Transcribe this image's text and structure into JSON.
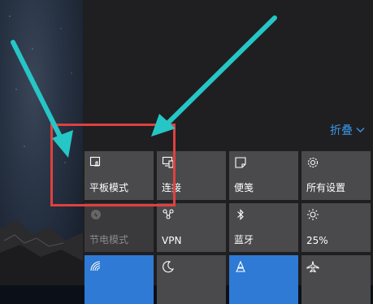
{
  "action_center": {
    "collapse_label": "折叠"
  },
  "tiles": [
    {
      "label": "平板模式",
      "icon": "tablet-mode-icon",
      "state": "active"
    },
    {
      "label": "连接",
      "icon": "connect-icon",
      "state": "normal"
    },
    {
      "label": "便笺",
      "icon": "note-icon",
      "state": "normal"
    },
    {
      "label": "所有设置",
      "icon": "gear-icon",
      "state": "normal"
    },
    {
      "label": "节电模式",
      "icon": "battery-saver-icon",
      "state": "disabled"
    },
    {
      "label": "VPN",
      "icon": "vpn-icon",
      "state": "normal"
    },
    {
      "label": "蓝牙",
      "icon": "bluetooth-icon",
      "state": "normal"
    },
    {
      "label": "25%",
      "icon": "brightness-icon",
      "state": "normal"
    },
    {
      "label": "",
      "icon": "wifi-icon",
      "state": "active"
    },
    {
      "label": "",
      "icon": "moon-icon",
      "state": "normal"
    },
    {
      "label": "",
      "icon": "location-icon",
      "state": "active"
    },
    {
      "label": "",
      "icon": "airplane-icon",
      "state": "normal"
    }
  ],
  "colors": {
    "accent": "#2f7ad4",
    "tile": "#4a4a4c",
    "panel": "#1f1f22",
    "annotation_red": "#e0403f",
    "annotation_cyan": "#26c6c6"
  }
}
